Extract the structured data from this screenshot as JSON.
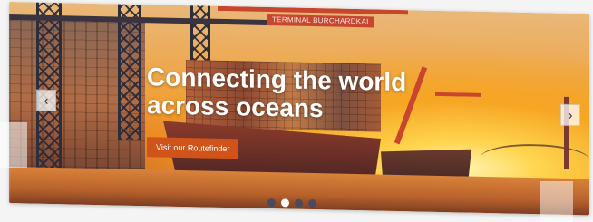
{
  "hero": {
    "headline_line1": "Connecting the world",
    "headline_line2": "across oceans",
    "cta_label": "Visit our Routefinder",
    "terminal_sign": "TERMINAL BURCHARDKAI",
    "prev_arrow": "‹",
    "next_arrow": "›",
    "slide_count": 4,
    "active_slide": 2
  },
  "colors": {
    "cta": "#d0531a",
    "dot_inactive": "#3b4b6a",
    "dot_active": "#ffffff"
  },
  "icons": {
    "prev": "chevron-left-icon",
    "next": "chevron-right-icon"
  }
}
